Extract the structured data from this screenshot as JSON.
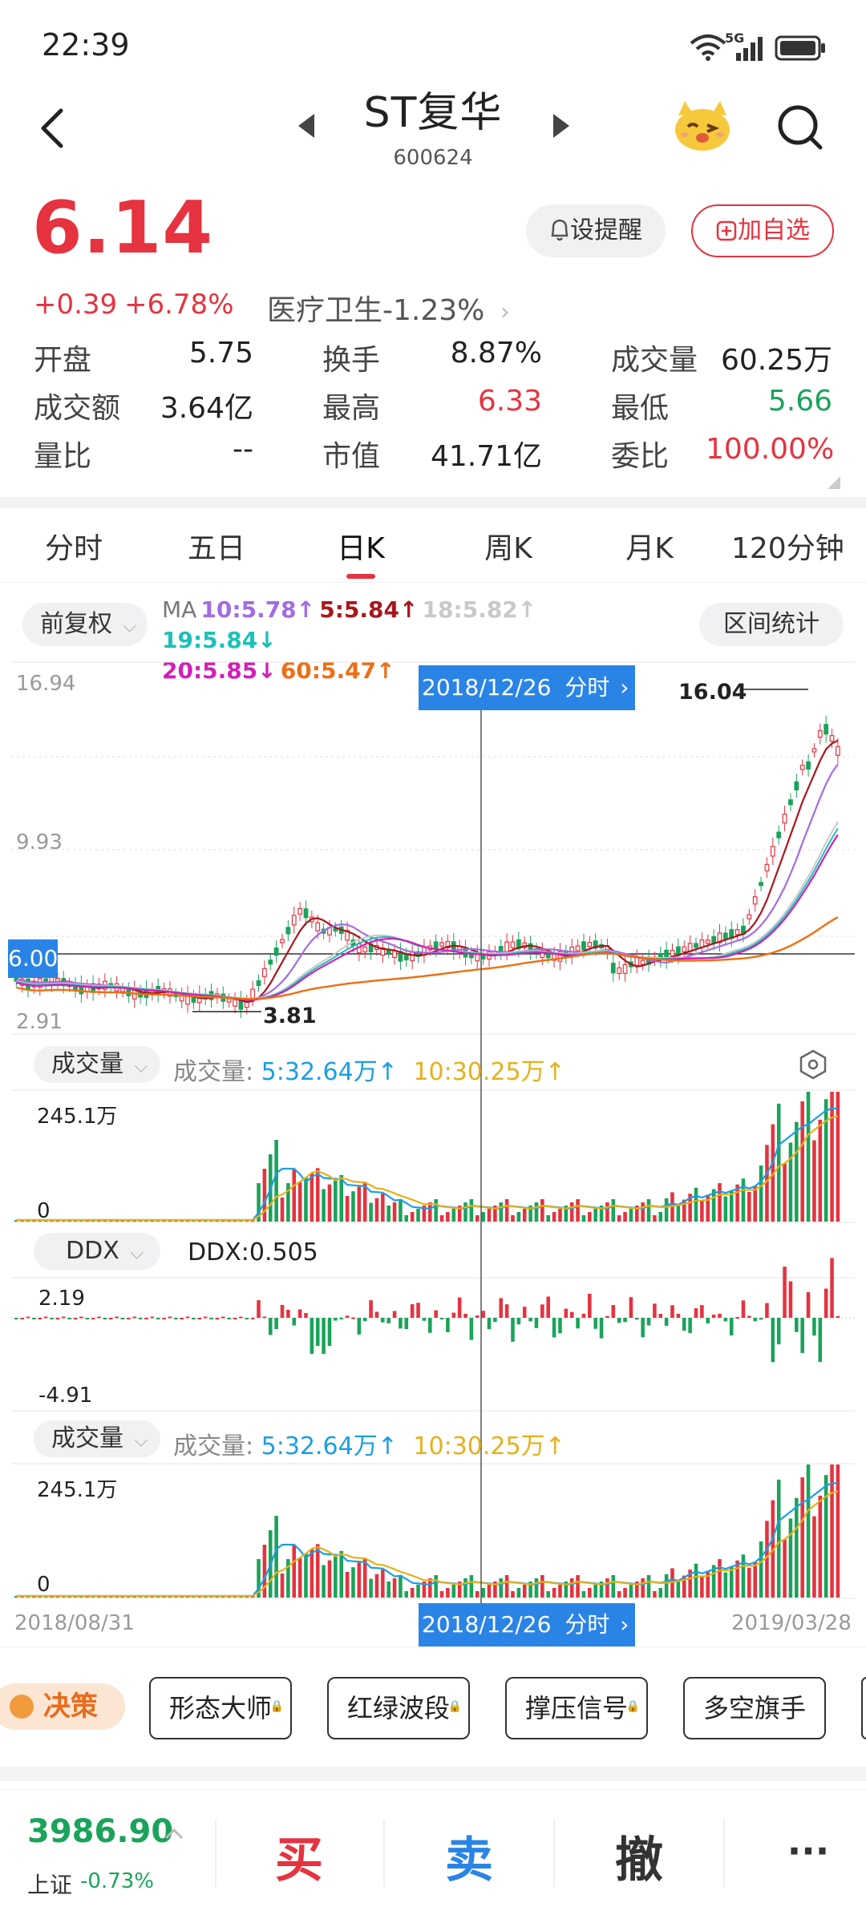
{
  "status": {
    "time": "22:39",
    "network": "5G"
  },
  "header": {
    "name": "ST复华",
    "code": "600624",
    "icons": {
      "back": "back-arrow-icon",
      "prev": "triangle-left-icon",
      "next": "triangle-right-icon",
      "mascot": "mascot-icon",
      "search": "search-icon"
    }
  },
  "quote": {
    "price": "6.14",
    "change": "+0.39",
    "change_pct": "+6.78%",
    "sector": "医疗卫生-1.23%",
    "alert_label": "设提醒",
    "watch_label": "加自选",
    "fields": [
      {
        "label": "开盘",
        "value": "5.75"
      },
      {
        "label": "换手",
        "value": "8.87%"
      },
      {
        "label": "成交量",
        "value": "60.25万"
      },
      {
        "label": "成交额",
        "value": "3.64亿"
      },
      {
        "label": "最高",
        "value": "6.33"
      },
      {
        "label": "最低",
        "value": "5.66"
      },
      {
        "label": "量比",
        "value": "--"
      },
      {
        "label": "市值",
        "value": "41.71亿"
      },
      {
        "label": "委比",
        "value": "100.00%"
      }
    ],
    "colors": {
      "up": "#e5333f",
      "down": "#1aa35a"
    }
  },
  "tabs": [
    "分时",
    "五日",
    "日K",
    "周K",
    "月K",
    "120分钟"
  ],
  "active_tab": "日K",
  "chart_toolbar": {
    "adjust": "前复权",
    "range_stats": "区间统计",
    "ma_prefix": "MA",
    "ma": [
      {
        "text": "10:5.78",
        "arrow": "↑",
        "color": "#a26ce4"
      },
      {
        "text": "5:5.84",
        "arrow": "↑",
        "color": "#a8171c"
      },
      {
        "text": "18:5.82",
        "arrow": "↑",
        "color": "#c9c9c9"
      },
      {
        "text": "19:5.84",
        "arrow": "↓",
        "color": "#1cc1b9"
      },
      {
        "text": "20:5.85",
        "arrow": "↓",
        "color": "#d21fb7"
      },
      {
        "text": "60:5.47",
        "arrow": "↑",
        "color": "#ee6e12"
      }
    ]
  },
  "kline": {
    "y_top": "16.94",
    "y_mid": "9.93",
    "y_bottom": "2.91",
    "current_price_tag": "6.00",
    "max_label": "16.04",
    "min_label": "3.81",
    "crosshair_date": "2018/12/26",
    "crosshair_link": "分时",
    "start_date": "2018/08/31",
    "end_date": "2019/03/28"
  },
  "volume_panel": {
    "selector": "成交量",
    "label": "成交量:",
    "ma5": "5:32.64万",
    "ma10": "10:30.25万",
    "arrow": "↑",
    "y_top": "245.1万",
    "y_bottom": "0",
    "settings_icon": "hexagon-settings-icon"
  },
  "ddx_panel": {
    "selector": "DDX",
    "value_text": "DDX:0.505",
    "y_top": "2.19",
    "y_bottom": "-4.91"
  },
  "volume_panel2": {
    "selector": "成交量",
    "label": "成交量:",
    "ma5": "5:32.64万",
    "ma10": "10:30.25万",
    "arrow": "↑",
    "y_top": "245.1万",
    "y_bottom": "0"
  },
  "decision": {
    "badge": "决策",
    "tools": [
      "形态大师",
      "红绿波段",
      "撑压信号",
      "多空旗手"
    ]
  },
  "bottom_bar": {
    "index_value": "3986.90",
    "index_name": "上证",
    "index_change": "-0.73%",
    "buy": "买",
    "sell": "卖",
    "cancel": "撤",
    "more": "···"
  }
}
